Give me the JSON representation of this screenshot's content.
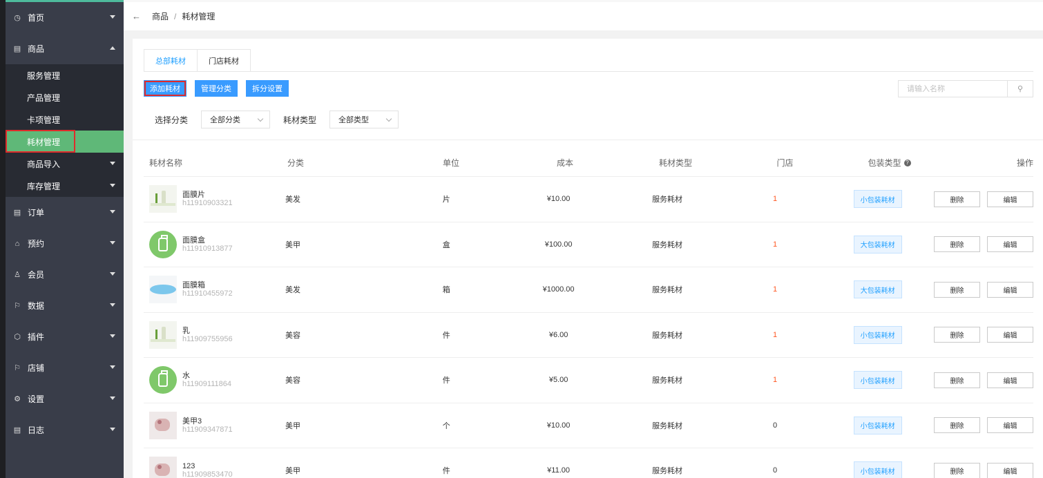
{
  "sidebar": {
    "items": [
      {
        "label": "首页",
        "icon": "dashboard-icon",
        "glyph": "◷"
      },
      {
        "label": "商品",
        "icon": "goods-icon",
        "glyph": "▤"
      },
      {
        "label": "订单",
        "icon": "order-icon",
        "glyph": "▤"
      },
      {
        "label": "预约",
        "icon": "home-icon",
        "glyph": "⌂"
      },
      {
        "label": "会员",
        "icon": "member-icon",
        "glyph": "♙"
      },
      {
        "label": "数据",
        "icon": "flag-icon",
        "glyph": "⚐"
      },
      {
        "label": "插件",
        "icon": "plugin-icon",
        "glyph": "⬡"
      },
      {
        "label": "店铺",
        "icon": "flag-icon",
        "glyph": "⚐"
      },
      {
        "label": "设置",
        "icon": "gear-icon",
        "glyph": "⚙"
      },
      {
        "label": "日志",
        "icon": "log-icon",
        "glyph": "▤"
      }
    ],
    "sub_items": [
      "服务管理",
      "产品管理",
      "卡项管理",
      "耗材管理",
      "商品导入",
      "库存管理"
    ]
  },
  "breadcrumb": {
    "back": "←",
    "parent": "商品",
    "sep": "/",
    "current": "耗材管理"
  },
  "tabs": [
    "总部耗材",
    "门店耗材"
  ],
  "toolbar": {
    "add": "添加耗材",
    "manage_category": "管理分类",
    "split_settings": "拆分设置"
  },
  "search": {
    "placeholder": "请输入名称",
    "icon": "search-icon",
    "glyph": "⚲"
  },
  "filters": {
    "category_label": "选择分类",
    "category_value": "全部分类",
    "type_label": "耗材类型",
    "type_value": "全部类型"
  },
  "table": {
    "headers": {
      "name": "耗材名称",
      "category": "分类",
      "unit": "单位",
      "cost": "成本",
      "type": "耗材类型",
      "store": "门店",
      "package": "包装类型",
      "ops": "操作"
    },
    "rows": [
      {
        "name": "面膜片",
        "code": "h11910903321",
        "category": "美发",
        "unit": "片",
        "cost": "¥10.00",
        "type": "服务耗材",
        "store": "1",
        "package": "小包装耗材",
        "thumb": "plant"
      },
      {
        "name": "面膜盒",
        "code": "h11910913877",
        "category": "美甲",
        "unit": "盒",
        "cost": "¥100.00",
        "type": "服务耗材",
        "store": "1",
        "package": "大包装耗材",
        "thumb": "green"
      },
      {
        "name": "面膜箱",
        "code": "h11910455972",
        "category": "美发",
        "unit": "箱",
        "cost": "¥1000.00",
        "type": "服务耗材",
        "store": "1",
        "package": "大包装耗材",
        "thumb": "plate"
      },
      {
        "name": "乳",
        "code": "h11909755956",
        "category": "美容",
        "unit": "件",
        "cost": "¥6.00",
        "type": "服务耗材",
        "store": "1",
        "package": "小包装耗材",
        "thumb": "plant"
      },
      {
        "name": "水",
        "code": "h11909111864",
        "category": "美容",
        "unit": "件",
        "cost": "¥5.00",
        "type": "服务耗材",
        "store": "1",
        "package": "小包装耗材",
        "thumb": "green"
      },
      {
        "name": "美甲3",
        "code": "h11909347871",
        "category": "美甲",
        "unit": "个",
        "cost": "¥10.00",
        "type": "服务耗材",
        "store": "0",
        "package": "小包装耗材",
        "thumb": "nail"
      },
      {
        "name": "123",
        "code": "h11909853470",
        "category": "美甲",
        "unit": "件",
        "cost": "¥11.00",
        "type": "服务耗材",
        "store": "0",
        "package": "小包装耗材",
        "thumb": "nail"
      }
    ],
    "delete_label": "删除",
    "edit_label": "编辑",
    "help_glyph": "?"
  }
}
